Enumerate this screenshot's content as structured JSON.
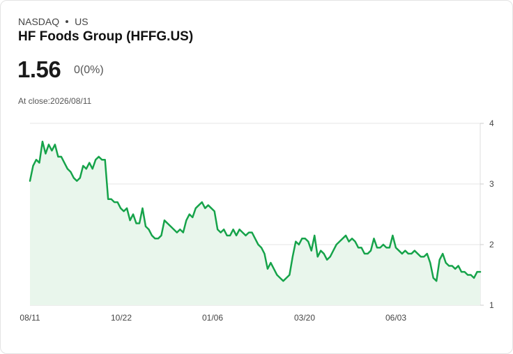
{
  "header": {
    "exchange": "NASDAQ",
    "market": "US",
    "name": "HF Foods Group (HFFG.US)",
    "price": "1.56",
    "change": "0(0%)",
    "at_close": "At close:2026/08/11"
  },
  "colors": {
    "line": "#16a34a",
    "fill": "#e9f6ec",
    "grid": "#e6e6e6"
  },
  "chart_data": {
    "type": "area",
    "title": "",
    "xlabel": "",
    "ylabel": "",
    "ylim": [
      1,
      4
    ],
    "yticks": [
      4,
      3,
      2,
      1
    ],
    "xtick_labels": [
      "08/11",
      "10/22",
      "01/06",
      "03/20",
      "06/03"
    ],
    "grid": true,
    "series": [
      {
        "values": [
          3.05,
          3.3,
          3.4,
          3.35,
          3.7,
          3.5,
          3.65,
          3.55,
          3.65,
          3.45,
          3.45,
          3.35,
          3.25,
          3.2,
          3.1,
          3.05,
          3.1,
          3.3,
          3.25,
          3.35,
          3.25,
          3.4,
          3.45,
          3.4,
          3.4,
          2.75,
          2.75,
          2.7,
          2.7,
          2.6,
          2.55,
          2.6,
          2.4,
          2.5,
          2.35,
          2.35,
          2.6,
          2.3,
          2.25,
          2.15,
          2.1,
          2.1,
          2.15,
          2.4,
          2.35,
          2.3,
          2.25,
          2.2,
          2.25,
          2.2,
          2.4,
          2.5,
          2.45,
          2.6,
          2.65,
          2.7,
          2.6,
          2.65,
          2.6,
          2.55,
          2.25,
          2.2,
          2.25,
          2.15,
          2.15,
          2.25,
          2.15,
          2.25,
          2.2,
          2.15,
          2.2,
          2.2,
          2.1,
          2.0,
          1.95,
          1.85,
          1.6,
          1.7,
          1.6,
          1.5,
          1.45,
          1.4,
          1.45,
          1.5,
          1.8,
          2.05,
          2.0,
          2.1,
          2.1,
          2.05,
          1.9,
          2.15,
          1.8,
          1.9,
          1.85,
          1.75,
          1.8,
          1.9,
          2.0,
          2.05,
          2.1,
          2.15,
          2.05,
          2.1,
          2.05,
          1.95,
          1.95,
          1.85,
          1.85,
          1.9,
          2.1,
          1.95,
          1.95,
          2.0,
          1.95,
          1.95,
          2.15,
          1.95,
          1.9,
          1.85,
          1.9,
          1.85,
          1.85,
          1.9,
          1.85,
          1.8,
          1.8,
          1.85,
          1.7,
          1.45,
          1.4,
          1.75,
          1.85,
          1.7,
          1.65,
          1.65,
          1.6,
          1.65,
          1.55,
          1.55,
          1.5,
          1.5,
          1.45,
          1.55,
          1.55
        ]
      }
    ]
  }
}
